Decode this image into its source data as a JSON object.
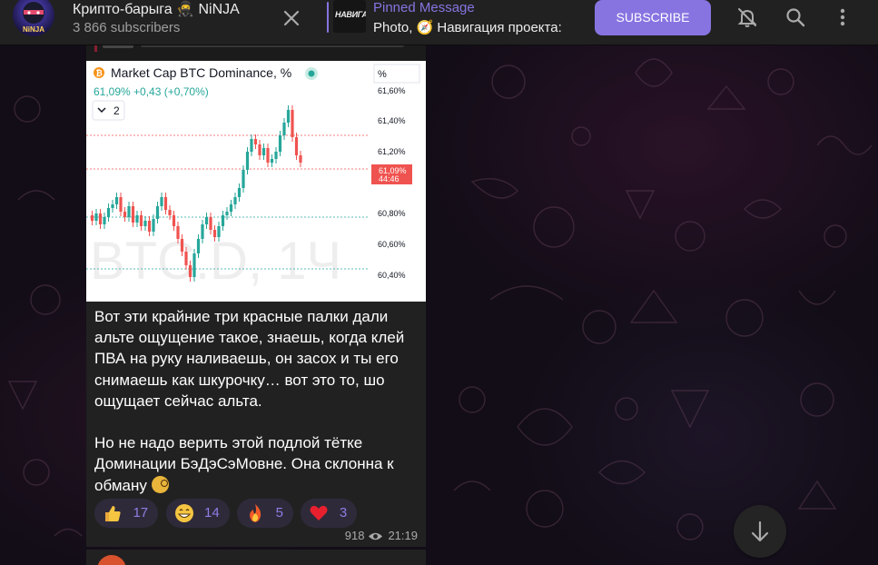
{
  "header": {
    "channel_title": "Крипто-барыга 🥷 NiNJA",
    "subscribers": "3 866 subscribers",
    "pinned_label": "Pinned Message",
    "pinned_text": "Photo, 🧭  Навигация проекта:",
    "pinned_thumb_text": "НАВИГА",
    "subscribe_label": "SUBSCRIBE",
    "avatar_text": "NiNJA",
    "icons": [
      "close-icon",
      "bell-off-icon",
      "search-icon",
      "more-vertical-icon"
    ]
  },
  "post_image": {
    "title": "Market Cap BTC Dominance, %",
    "value_line": "61,09% +0,43 (+0,70%)",
    "interval_label": "2",
    "scale_label": "%",
    "price_tag": "61,09%",
    "price_tag_time": "44:46",
    "watermark": "BTC.D, 1Ч",
    "y_ticks": [
      "61,60%",
      "61,40%",
      "61,20%",
      "60,80%",
      "60,60%",
      "60,40%"
    ],
    "colors": {
      "up": "#26a69a",
      "down": "#ef5350",
      "brand": "#f7931a"
    }
  },
  "message": {
    "paragraph1": "Вот эти крайние три красные палки дали альте ощущение такое, знаешь, когда клей ПВА на руку наливаешь, он засох и ты его снимаешь как шкурочку… вот это то, шо ощущает сейчас альта.",
    "paragraph2": "Но не надо верить этой подлой тётке Доминации БэДэСэМовне. Она склонна к обману",
    "reactions": [
      {
        "emoji": "thumbs-up-icon",
        "count": "17"
      },
      {
        "emoji": "grinning-face-icon",
        "count": "14"
      },
      {
        "emoji": "fire-icon",
        "count": "5"
      },
      {
        "emoji": "red-heart-icon",
        "count": "3"
      }
    ],
    "views": "918",
    "time": "21:19"
  },
  "colors": {
    "accent": "#8774e1",
    "panel": "#212121",
    "reaction_bg": "#2f2a3a"
  }
}
